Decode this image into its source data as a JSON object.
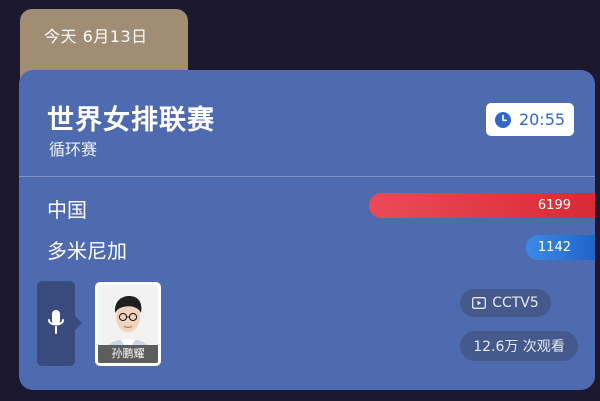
{
  "date_tab": {
    "label": "今天 6月13日"
  },
  "match": {
    "title": "世界女排联赛",
    "subtitle": "循环赛",
    "time": "20:55"
  },
  "teams": [
    {
      "name": "中国",
      "votes": "6199",
      "color": "#e23a46"
    },
    {
      "name": "多米尼加",
      "votes": "1142",
      "color": "#2e76d8"
    }
  ],
  "commentator": {
    "name": "孙鹏耀"
  },
  "channel": {
    "label": "CCTV5"
  },
  "views": {
    "label": "12.6万 次观看"
  },
  "icons": {
    "clock": "clock-icon",
    "mic": "microphone-icon",
    "tv": "tv-icon"
  }
}
